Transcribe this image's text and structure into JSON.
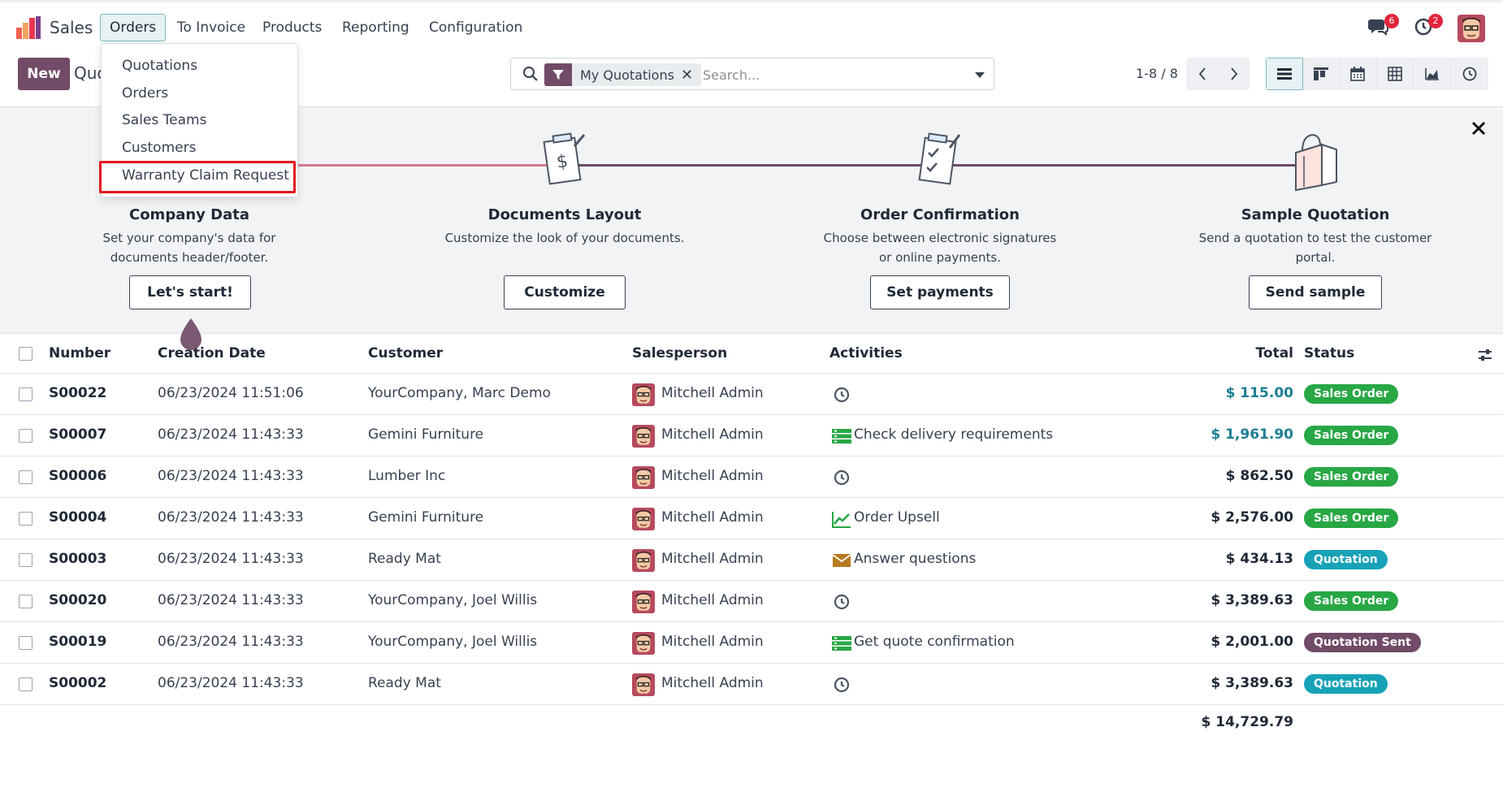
{
  "app": {
    "name": "Sales"
  },
  "nav": {
    "orders": "Orders",
    "to_invoice": "To Invoice",
    "products": "Products",
    "reporting": "Reporting",
    "configuration": "Configuration"
  },
  "systray": {
    "messages_count": "6",
    "activities_count": "2",
    "messages_icon": "chat-bubbles-icon",
    "activities_icon": "clock-icon"
  },
  "control": {
    "new_label": "New",
    "title": "Quotations",
    "title_visible": "Quo",
    "pager": "1-8 / 8"
  },
  "search": {
    "facet": "My Quotations",
    "placeholder": "Search..."
  },
  "dropdown": {
    "items": [
      "Quotations",
      "Orders",
      "Sales Teams",
      "Customers",
      "Warranty Claim Request"
    ],
    "highlighted": "Warranty Claim Request"
  },
  "onboarding": {
    "steps": [
      {
        "title": "Company Data",
        "desc": "Set your company's data for documents header/footer.",
        "button": "Let's start!",
        "icon": "building-icon"
      },
      {
        "title": "Documents Layout",
        "desc": "Customize the look of your documents.",
        "button": "Customize",
        "icon": "document-dollar-icon"
      },
      {
        "title": "Order Confirmation",
        "desc": "Choose between electronic signatures or online payments.",
        "button": "Set payments",
        "icon": "checklist-icon"
      },
      {
        "title": "Sample Quotation",
        "desc": "Send a quotation to test the customer portal.",
        "button": "Send sample",
        "icon": "shopping-bag-icon"
      }
    ]
  },
  "table": {
    "headers": {
      "number": "Number",
      "creation_date": "Creation Date",
      "customer": "Customer",
      "salesperson": "Salesperson",
      "activities": "Activities",
      "total": "Total",
      "status": "Status"
    },
    "rows": [
      {
        "number": "S00022",
        "date": "06/23/2024 11:51:06",
        "customer": "YourCompany, Marc Demo",
        "salesperson": "Mitchell Admin",
        "activity": "",
        "activity_icon": "clock-icon",
        "total": "$ 115.00",
        "status": "Sales Order"
      },
      {
        "number": "S00007",
        "date": "06/23/2024 11:43:33",
        "customer": "Gemini Furniture",
        "salesperson": "Mitchell Admin",
        "activity": "Check delivery requirements",
        "activity_icon": "list-icon",
        "total": "$ 1,961.90",
        "status": "Sales Order"
      },
      {
        "number": "S00006",
        "date": "06/23/2024 11:43:33",
        "customer": "Lumber Inc",
        "salesperson": "Mitchell Admin",
        "activity": "",
        "activity_icon": "clock-icon",
        "total": "$ 862.50",
        "status": "Sales Order"
      },
      {
        "number": "S00004",
        "date": "06/23/2024 11:43:33",
        "customer": "Gemini Furniture",
        "salesperson": "Mitchell Admin",
        "activity": "Order Upsell",
        "activity_icon": "trend-chart-icon",
        "total": "$ 2,576.00",
        "status": "Sales Order"
      },
      {
        "number": "S00003",
        "date": "06/23/2024 11:43:33",
        "customer": "Ready Mat",
        "salesperson": "Mitchell Admin",
        "activity": "Answer questions",
        "activity_icon": "envelope-icon",
        "total": "$ 434.13",
        "status": "Quotation"
      },
      {
        "number": "S00020",
        "date": "06/23/2024 11:43:33",
        "customer": "YourCompany, Joel Willis",
        "salesperson": "Mitchell Admin",
        "activity": "",
        "activity_icon": "clock-icon",
        "total": "$ 3,389.63",
        "status": "Sales Order"
      },
      {
        "number": "S00019",
        "date": "06/23/2024 11:43:33",
        "customer": "YourCompany, Joel Willis",
        "salesperson": "Mitchell Admin",
        "activity": "Get quote confirmation",
        "activity_icon": "list-icon",
        "total": "$ 2,001.00",
        "status": "Quotation Sent"
      },
      {
        "number": "S00002",
        "date": "06/23/2024 11:43:33",
        "customer": "Ready Mat",
        "salesperson": "Mitchell Admin",
        "activity": "",
        "activity_icon": "clock-icon",
        "total": "$ 3,389.63",
        "status": "Quotation"
      }
    ],
    "grand_total": "$ 14,729.79"
  },
  "colors": {
    "brand": "#714b67",
    "accent": "#1c7e93",
    "sales_order": "#28a745",
    "quotation": "#17a2b8",
    "quotation_sent": "#714b67",
    "highlight": "#e1161f"
  }
}
